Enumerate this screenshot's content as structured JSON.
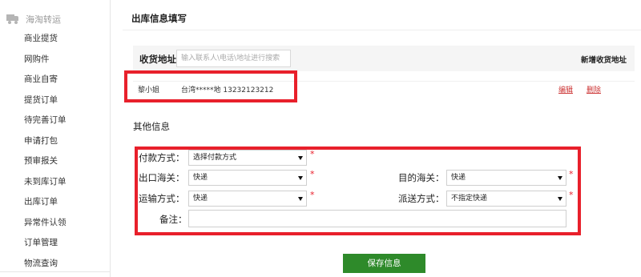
{
  "sidebar": {
    "header": "海淘转运",
    "header_icon": "truck-icon",
    "items": [
      "商业提货",
      "网购件",
      "商业自寄",
      "提货订单",
      "待完善订单",
      "申请打包",
      "预审报关",
      "未到库订单",
      "出库订单",
      "异常件认领",
      "订单管理",
      "物流查询"
    ]
  },
  "page": {
    "title": "出库信息填写"
  },
  "address": {
    "label": "收货地址",
    "search_placeholder": "输入联系人\\电话\\地址进行搜索",
    "new_label": "新增收货地址",
    "entry": {
      "name": "黎小姐",
      "detail": "台湾*****地 13232123212",
      "edit_label": "编辑",
      "delete_label": "删除"
    }
  },
  "other": {
    "title": "其他信息",
    "payment_label": "付款方式：",
    "payment_value": "选择付款方式",
    "export_port_label": "出口海关：",
    "export_port_value": "快递",
    "dest_port_label": "目的海关：",
    "dest_port_value": "快递",
    "transport_label": "运输方式：",
    "transport_value": "快递",
    "delivery_label": "派送方式：",
    "delivery_value": "不指定快递",
    "remark_label": "备注：",
    "required_mark": "*"
  },
  "actions": {
    "save_label": "保存信息"
  },
  "colors": {
    "highlight": "#e8202b",
    "save_button": "#2e8a2a",
    "link": "#cc3333"
  }
}
